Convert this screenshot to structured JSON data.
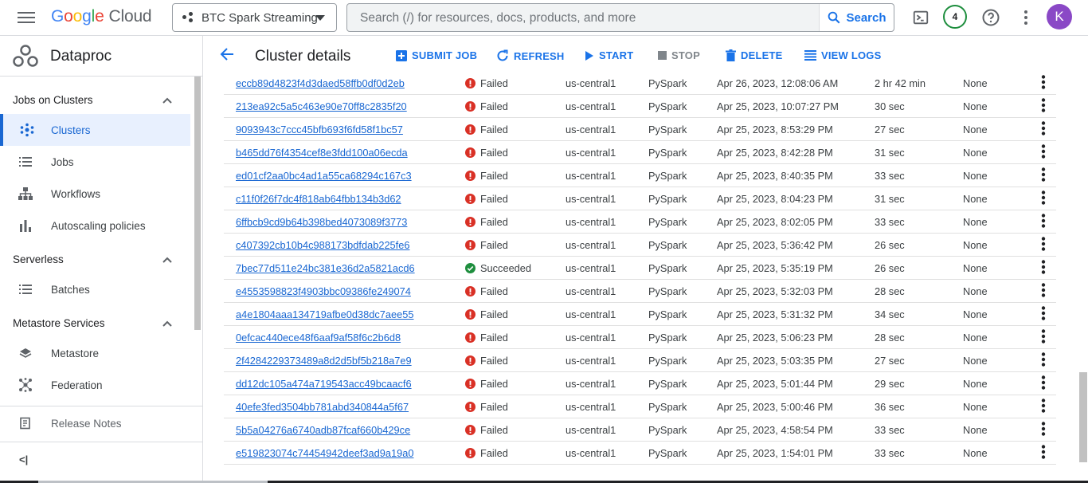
{
  "header": {
    "logo": {
      "g1": "G",
      "g2": "o",
      "g3": "o",
      "g4": "g",
      "g5": "l",
      "g6": "e",
      "cloud": "Cloud"
    },
    "project_name": "BTC Spark Streaming",
    "search_placeholder": "Search (/) for resources, docs, products, and more",
    "search_button": "Search",
    "notifications_count": "4",
    "avatar_letter": "K"
  },
  "sidebar": {
    "product_title": "Dataproc",
    "sections": {
      "jobs_on_clusters": "Jobs on Clusters",
      "serverless": "Serverless",
      "metastore_services": "Metastore Services"
    },
    "items": {
      "clusters": "Clusters",
      "jobs": "Jobs",
      "workflows": "Workflows",
      "autoscaling": "Autoscaling policies",
      "batches": "Batches",
      "metastore": "Metastore",
      "federation": "Federation"
    },
    "release_notes": "Release Notes",
    "collapse_label": "<|"
  },
  "page": {
    "title": "Cluster details",
    "actions": {
      "submit_job": "SUBMIT JOB",
      "refresh": "REFRESH",
      "start": "START",
      "stop": "STOP",
      "delete": "DELETE",
      "view_logs": "VIEW LOGS"
    }
  },
  "colors": {
    "accent": "#1a73e8",
    "failed": "#d93025",
    "succeeded": "#1e8e3e"
  },
  "jobs": [
    {
      "id": "eccb89d4823f4d3daed58ffb0df0d2eb",
      "status": "Failed",
      "region": "us-central1",
      "type": "PySpark",
      "submitted": "Apr 26, 2023, 12:08:06 AM",
      "elapsed": "2 hr 42 min",
      "labels": "None"
    },
    {
      "id": "213ea92c5a5c463e90e70ff8c2835f20",
      "status": "Failed",
      "region": "us-central1",
      "type": "PySpark",
      "submitted": "Apr 25, 2023, 10:07:27 PM",
      "elapsed": "30 sec",
      "labels": "None"
    },
    {
      "id": "9093943c7ccc45bfb693f6fd58f1bc57",
      "status": "Failed",
      "region": "us-central1",
      "type": "PySpark",
      "submitted": "Apr 25, 2023, 8:53:29 PM",
      "elapsed": "27 sec",
      "labels": "None"
    },
    {
      "id": "b465dd76f4354cef8e3fdd100a06ecda",
      "status": "Failed",
      "region": "us-central1",
      "type": "PySpark",
      "submitted": "Apr 25, 2023, 8:42:28 PM",
      "elapsed": "31 sec",
      "labels": "None"
    },
    {
      "id": "ed01cf2aa0bc4ad1a55ca68294c167c3",
      "status": "Failed",
      "region": "us-central1",
      "type": "PySpark",
      "submitted": "Apr 25, 2023, 8:40:35 PM",
      "elapsed": "33 sec",
      "labels": "None"
    },
    {
      "id": "c11f0f26f7dc4f818ab64fbb134b3d62",
      "status": "Failed",
      "region": "us-central1",
      "type": "PySpark",
      "submitted": "Apr 25, 2023, 8:04:23 PM",
      "elapsed": "31 sec",
      "labels": "None"
    },
    {
      "id": "6ffbcb9cd9b64b398bed4073089f3773",
      "status": "Failed",
      "region": "us-central1",
      "type": "PySpark",
      "submitted": "Apr 25, 2023, 8:02:05 PM",
      "elapsed": "33 sec",
      "labels": "None"
    },
    {
      "id": "c407392cb10b4c988173bdfdab225fe6",
      "status": "Failed",
      "region": "us-central1",
      "type": "PySpark",
      "submitted": "Apr 25, 2023, 5:36:42 PM",
      "elapsed": "26 sec",
      "labels": "None"
    },
    {
      "id": "7bec77d511e24bc381e36d2a5821acd6",
      "status": "Succeeded",
      "region": "us-central1",
      "type": "PySpark",
      "submitted": "Apr 25, 2023, 5:35:19 PM",
      "elapsed": "26 sec",
      "labels": "None"
    },
    {
      "id": "e4553598823f4903bbc09386fe249074",
      "status": "Failed",
      "region": "us-central1",
      "type": "PySpark",
      "submitted": "Apr 25, 2023, 5:32:03 PM",
      "elapsed": "28 sec",
      "labels": "None"
    },
    {
      "id": "a4e1804aaa134719afbe0d38dc7aee55",
      "status": "Failed",
      "region": "us-central1",
      "type": "PySpark",
      "submitted": "Apr 25, 2023, 5:31:32 PM",
      "elapsed": "34 sec",
      "labels": "None"
    },
    {
      "id": "0efcac440ece48f6aaf9af58f6c2b6d8",
      "status": "Failed",
      "region": "us-central1",
      "type": "PySpark",
      "submitted": "Apr 25, 2023, 5:06:23 PM",
      "elapsed": "28 sec",
      "labels": "None"
    },
    {
      "id": "2f4284229373489a8d2d5bf5b218a7e9",
      "status": "Failed",
      "region": "us-central1",
      "type": "PySpark",
      "submitted": "Apr 25, 2023, 5:03:35 PM",
      "elapsed": "27 sec",
      "labels": "None"
    },
    {
      "id": "dd12dc105a474a719543acc49bcaacf6",
      "status": "Failed",
      "region": "us-central1",
      "type": "PySpark",
      "submitted": "Apr 25, 2023, 5:01:44 PM",
      "elapsed": "29 sec",
      "labels": "None"
    },
    {
      "id": "40efe3fed3504bb781abd340844a5f67",
      "status": "Failed",
      "region": "us-central1",
      "type": "PySpark",
      "submitted": "Apr 25, 2023, 5:00:46 PM",
      "elapsed": "36 sec",
      "labels": "None"
    },
    {
      "id": "5b5a04276a6740adb87fcaf660b429ce",
      "status": "Failed",
      "region": "us-central1",
      "type": "PySpark",
      "submitted": "Apr 25, 2023, 4:58:54 PM",
      "elapsed": "33 sec",
      "labels": "None"
    },
    {
      "id": "e519823074c74454942deef3ad9a19a0",
      "status": "Failed",
      "region": "us-central1",
      "type": "PySpark",
      "submitted": "Apr 25, 2023, 1:54:01 PM",
      "elapsed": "33 sec",
      "labels": "None"
    }
  ]
}
